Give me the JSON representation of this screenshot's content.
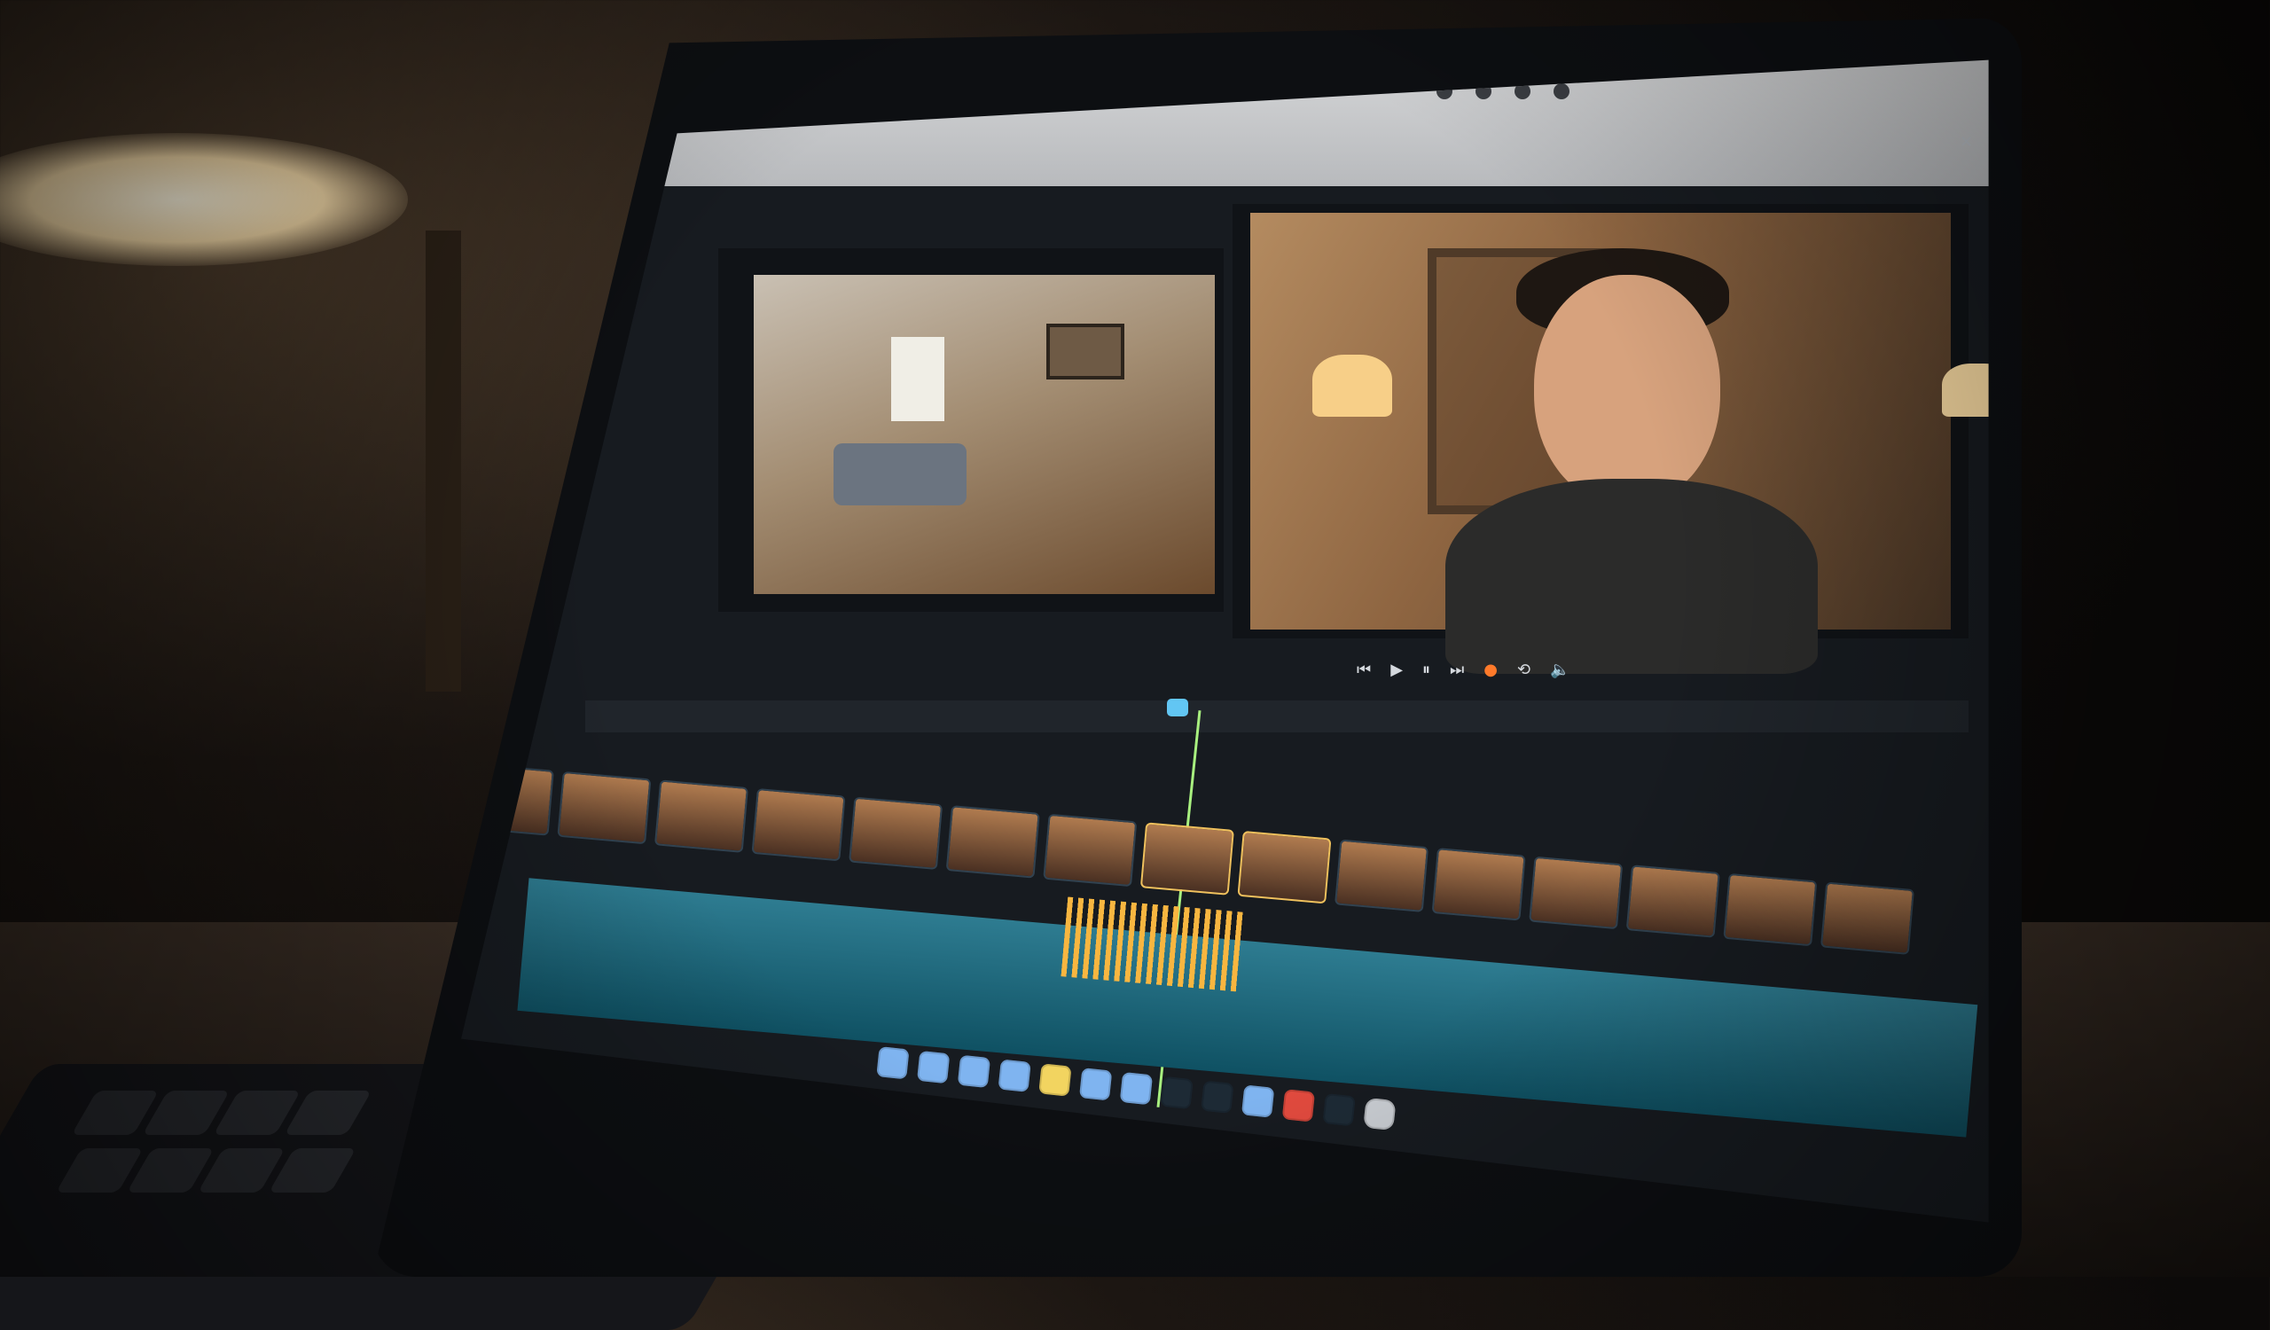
{
  "scene": {
    "description_labels": {
      "menu_items": [],
      "status_text": []
    },
    "transport_controls": {
      "icons": [
        "rewind-icon",
        "play-icon",
        "pause-icon",
        "forward-icon",
        "record-icon",
        "loop-icon",
        "volume-icon"
      ]
    },
    "timeline": {
      "clip_count": 15,
      "selected_clips": [
        7,
        8
      ]
    },
    "dock": {
      "icons": [
        "finder-icon",
        "launchpad-icon",
        "safari-icon",
        "chrome-icon",
        "notes-icon",
        "mail-icon",
        "photos-icon",
        "calendar-icon",
        "music-icon",
        "camera-icon",
        "power-icon",
        "video-icon",
        "trash-icon"
      ]
    },
    "colors": {
      "accent_playhead": "#a8f07f",
      "selected_clip_border": "#f0c15d",
      "record": "#ff7a2a",
      "waveform": "#2e7c91",
      "waveform_highlight": "#f8b640"
    }
  }
}
